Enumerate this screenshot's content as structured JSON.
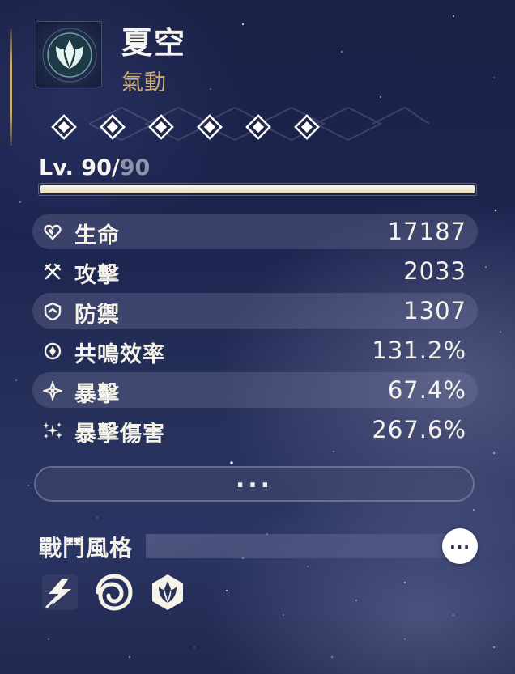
{
  "character": {
    "name": "夏空",
    "element": "氣動",
    "element_color": "#c9ad72",
    "emblem_icon": "aero-crest-icon"
  },
  "resonance_chain": {
    "total": 6,
    "unlocked": 6,
    "node_icon": "diamond-icon"
  },
  "level": {
    "prefix": "Lv.",
    "current": "90",
    "separator": "/",
    "max": "90",
    "progress": 1.0
  },
  "stats": [
    {
      "label": "生命",
      "value": "17187",
      "icon": "hp-heart-icon"
    },
    {
      "label": "攻擊",
      "value": "2033",
      "icon": "attack-swords-icon"
    },
    {
      "label": "防禦",
      "value": "1307",
      "icon": "defense-shield-icon"
    },
    {
      "label": "共鳴效率",
      "value": "131.2%",
      "icon": "energy-regen-icon"
    },
    {
      "label": "暴擊",
      "value": "67.4%",
      "icon": "crit-rate-icon"
    },
    {
      "label": "暴擊傷害",
      "value": "267.6%",
      "icon": "crit-damage-icon"
    }
  ],
  "more_button": {
    "label": "..."
  },
  "combat_style": {
    "title": "戰鬥風格",
    "more_label": "...",
    "icons": [
      "lightning-slash-icon",
      "spiral-vortex-icon",
      "aero-crest-badge-icon"
    ]
  },
  "colors": {
    "accent_gold": "#c9b078",
    "text_main": "#f5f2ea",
    "level_max_grey": "#8e93a8"
  }
}
